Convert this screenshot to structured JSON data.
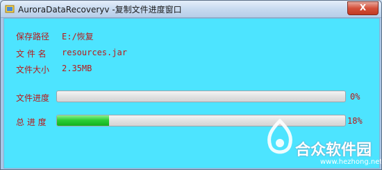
{
  "window": {
    "title": "AuroraDataRecoveryv -复制文件进度窗口",
    "close_glyph": "X",
    "accent_bg": "#4de4ff",
    "label_color": "#b81818"
  },
  "info": {
    "path_label": "保存路径",
    "path_value": "E:/恢复",
    "name_label": "文 件 名",
    "name_value": "resources.jar",
    "size_label": "文件大小",
    "size_value": "2.35MB"
  },
  "progress": {
    "file_label": "文件进度",
    "file_percent_text": "0%",
    "file_value": 0,
    "total_label": "总 进 度",
    "total_percent_text": "18%",
    "total_value": 18
  },
  "watermark": {
    "brand": "合众软件园",
    "url": "www.hezhong.net"
  },
  "icons": {
    "app": "app-icon",
    "close": "close-icon",
    "logo": "watermark-logo-icon"
  }
}
